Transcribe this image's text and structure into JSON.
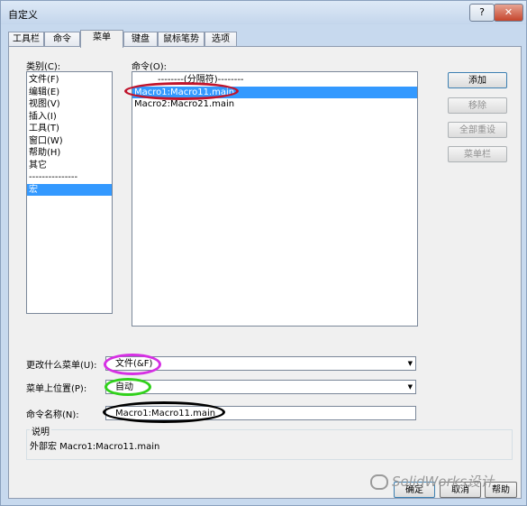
{
  "window": {
    "title": "自定义",
    "help_label": "?",
    "close_label": "✕"
  },
  "tabs": [
    {
      "label": "工具栏",
      "active": false
    },
    {
      "label": "命令",
      "active": false
    },
    {
      "label": "菜单",
      "active": true
    },
    {
      "label": "键盘",
      "active": false
    },
    {
      "label": "鼠标笔势",
      "active": false
    },
    {
      "label": "选项",
      "active": false
    }
  ],
  "categories": {
    "label": "类别(C):",
    "items": [
      "文件(F)",
      "编辑(E)",
      "视图(V)",
      "插入(I)",
      "工具(T)",
      "窗口(W)",
      "帮助(H)",
      "其它",
      "---------------",
      "宏"
    ],
    "selected_index": 9
  },
  "commands": {
    "label": "命令(O):",
    "items": [
      "--------(分隔符)--------",
      "Macro1:Macro11.main",
      "Macro2:Macro21.main"
    ],
    "selected_index": 1
  },
  "buttons": {
    "add": "添加",
    "remove": "移除",
    "reset_all": "全部重设",
    "menu_bar": "菜单栏"
  },
  "change_menu": {
    "label": "更改什么菜单(U):",
    "value": "文件(&F)"
  },
  "menu_position": {
    "label": "菜单上位置(P):",
    "value": "自动"
  },
  "command_name": {
    "label": "命令名称(N):",
    "value": "Macro1:Macro11.main"
  },
  "description": {
    "title": "说明",
    "text": "外部宏 Macro1:Macro11.main"
  },
  "footer": {
    "ok": "确定",
    "cancel": "取消",
    "help": "帮助"
  },
  "watermark": {
    "text": "SolidWorks设计"
  },
  "colors": {
    "highlight": "#3399ff",
    "annotation_red": "#c0142c",
    "annotation_magenta": "#d630e4",
    "annotation_green": "#31d11c",
    "annotation_black": "#000000"
  },
  "icons": {
    "watermark_logo": "wechat-logo-icon",
    "dropdown": "chevron-down-icon"
  }
}
